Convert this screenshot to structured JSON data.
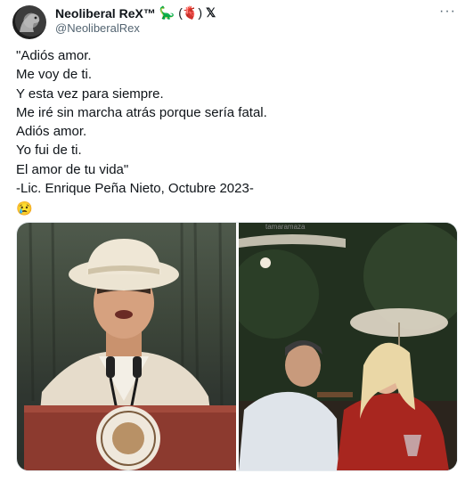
{
  "tweet": {
    "display_name": "Neoliberal ReX™",
    "name_emoji_1": "🦕",
    "name_emoji_2": "(🫀)",
    "x_mark": "𝕏",
    "handle": "@NeoliberalRex",
    "more_label": "···",
    "lines": [
      "\"Adiós amor.",
      "Me voy de ti.",
      "Y esta vez para siempre.",
      "Me iré sin marcha atrás porque sería fatal.",
      "Adiós amor.",
      "Yo fui de ti.",
      "El amor de tu vida\"",
      "-Lic. Enrique Peña Nieto, Octubre 2023-"
    ],
    "trailing_emoji": "😢"
  },
  "media": {
    "left_image": "man-in-white-hat-at-podium-photo",
    "right_image": "couple-at-restaurant-photo",
    "right_top_label": "tamaramaza"
  },
  "colors": {
    "text": "#0f1419",
    "secondary": "#536471"
  }
}
